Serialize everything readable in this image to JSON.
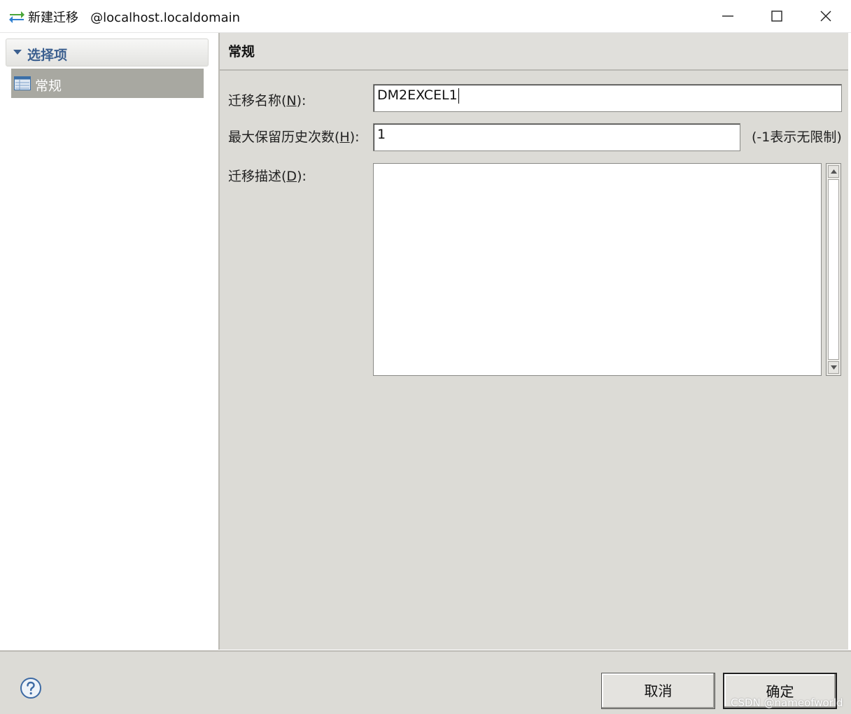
{
  "window": {
    "title": "新建迁移",
    "host": "@localhost.localdomain",
    "controls": {
      "minimize": "minimize-icon",
      "maximize": "maximize-icon",
      "close": "close-icon"
    }
  },
  "sidebar": {
    "header": "选择项",
    "items": [
      {
        "label": "常规",
        "icon": "table-icon",
        "selected": true
      }
    ]
  },
  "section": {
    "title": "常规",
    "fields": {
      "name": {
        "label": "迁移名称(",
        "mnemonic": "N",
        "suffix": "):",
        "value": "DM2EXCEL1"
      },
      "max_history": {
        "label": "最大保留历史次数(",
        "mnemonic": "H",
        "suffix": "):",
        "value": "1",
        "hint": "(-1表示无限制)"
      },
      "description": {
        "label": "迁移描述(",
        "mnemonic": "D",
        "suffix": "):",
        "value": ""
      }
    }
  },
  "footer": {
    "help_icon": "help-icon",
    "cancel_label": "取消",
    "ok_label": "确定",
    "watermark": "CSDN @nameofworld"
  },
  "colors": {
    "panel_bg": "#dcdbd6",
    "selected_item_bg": "#a8a8a1",
    "header_text": "#3b5f8f"
  }
}
